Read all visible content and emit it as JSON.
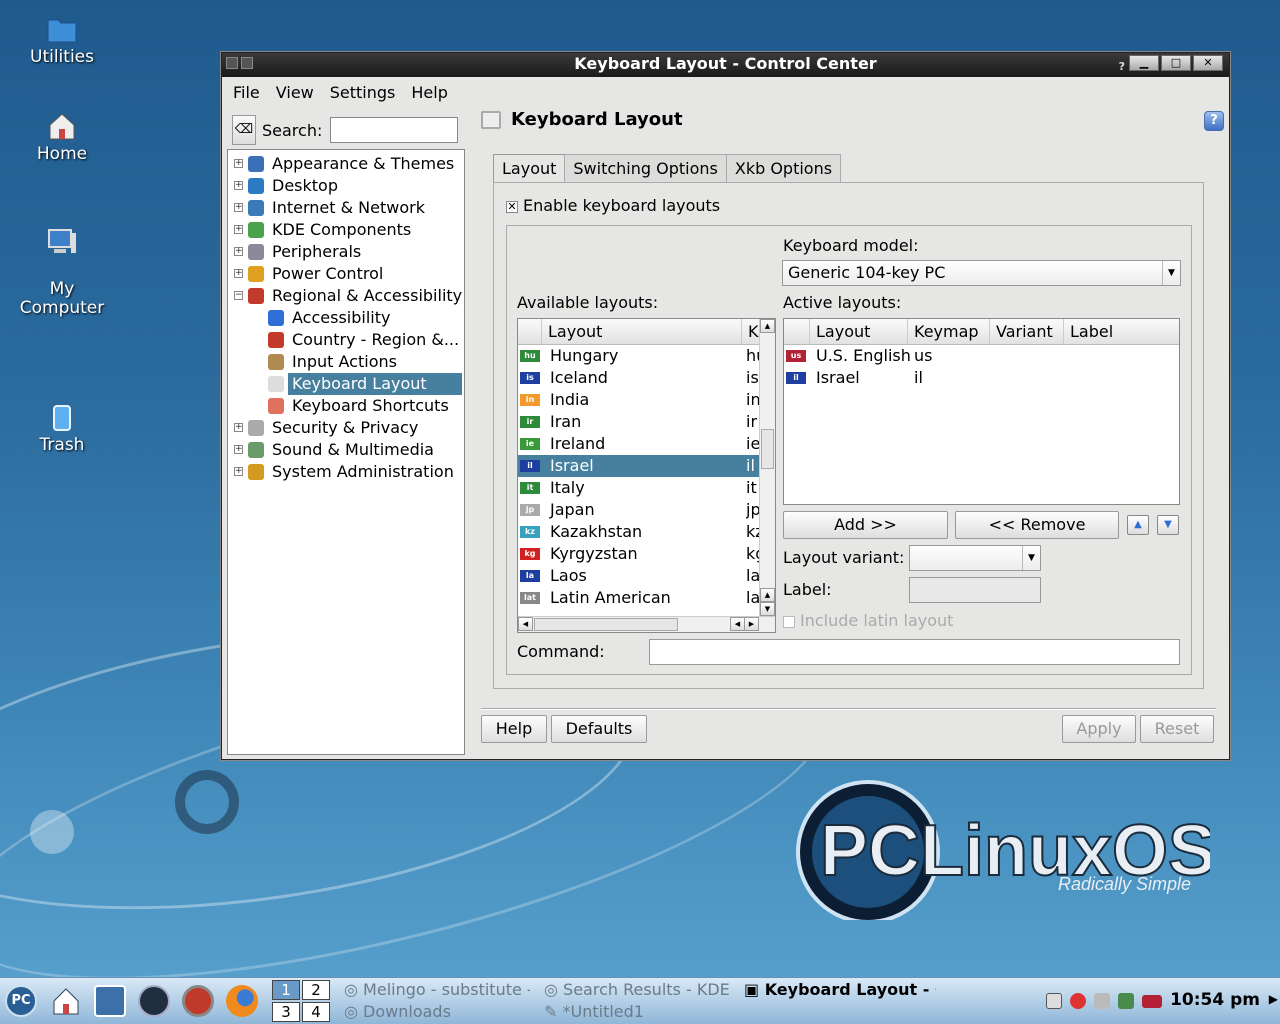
{
  "desktop": {
    "icons": [
      {
        "label": "Utilities",
        "icon": "folder-icon"
      },
      {
        "label": "Home",
        "icon": "home-icon"
      },
      {
        "label": "My\nComputer",
        "icon": "computer-icon"
      },
      {
        "label": "Trash",
        "icon": "trash-icon"
      }
    ],
    "logo": {
      "brand": "PCLinuxOS",
      "tagline": "Radically Simple"
    }
  },
  "window": {
    "title": "Keyboard Layout - Control Center",
    "title_help": "?",
    "menu": [
      "File",
      "View",
      "Settings",
      "Help"
    ],
    "search_label": "Search:",
    "search_value": "",
    "tree": [
      {
        "label": "Appearance & Themes",
        "expander": "+",
        "level": 0,
        "icon_color": "#3b6fb6"
      },
      {
        "label": "Desktop",
        "expander": "+",
        "level": 0,
        "icon_color": "#2a7bc2"
      },
      {
        "label": "Internet & Network",
        "expander": "+",
        "level": 0,
        "icon_color": "#3c79b7"
      },
      {
        "label": "KDE Components",
        "expander": "+",
        "level": 0,
        "icon_color": "#4aa24a"
      },
      {
        "label": "Peripherals",
        "expander": "+",
        "level": 0,
        "icon_color": "#8a8a9a"
      },
      {
        "label": "Power Control",
        "expander": "+",
        "level": 0,
        "icon_color": "#e0a020"
      },
      {
        "label": "Regional & Accessibility",
        "expander": "−",
        "level": 0,
        "icon_color": "#c23a2a"
      },
      {
        "label": "Accessibility",
        "expander": "",
        "level": 1,
        "icon_color": "#2f6ed8"
      },
      {
        "label": "Country - Region &...",
        "expander": "",
        "level": 1,
        "icon_color": "#c23a2a"
      },
      {
        "label": "Input Actions",
        "expander": "",
        "level": 1,
        "icon_color": "#b08a50"
      },
      {
        "label": "Keyboard Layout",
        "expander": "",
        "level": 1,
        "icon_color": "#dddddd",
        "selected": true
      },
      {
        "label": "Keyboard Shortcuts",
        "expander": "",
        "level": 1,
        "icon_color": "#e07060"
      },
      {
        "label": "Security & Privacy",
        "expander": "+",
        "level": 0,
        "icon_color": "#aaaaaa"
      },
      {
        "label": "Sound & Multimedia",
        "expander": "+",
        "level": 0,
        "icon_color": "#6a9a6a"
      },
      {
        "label": "System Administration",
        "expander": "+",
        "level": 0,
        "icon_color": "#d49a20"
      }
    ],
    "panel_title": "Keyboard Layout",
    "tabs": [
      "Layout",
      "Switching Options",
      "Xkb Options"
    ],
    "enable_label": "Enable keyboard layouts",
    "enable_checked": "✕",
    "model_label": "Keyboard model:",
    "model_value": "Generic 104-key PC",
    "available_label": "Available layouts:",
    "available_headers": [
      "Layout",
      "K"
    ],
    "available": [
      {
        "flag": "hu",
        "name": "Hungary",
        "code": "hu",
        "flag_color": "#2e8b3a"
      },
      {
        "flag": "is",
        "name": "Iceland",
        "code": "is",
        "flag_color": "#1e3fa0"
      },
      {
        "flag": "in",
        "name": "India",
        "code": "in",
        "flag_color": "#f29a2e"
      },
      {
        "flag": "ir",
        "name": "Iran",
        "code": "ir",
        "flag_color": "#2e8b3a"
      },
      {
        "flag": "ie",
        "name": "Ireland",
        "code": "ie",
        "flag_color": "#3a9a3a"
      },
      {
        "flag": "il",
        "name": "Israel",
        "code": "il",
        "flag_color": "#1e3fa0",
        "selected": true
      },
      {
        "flag": "it",
        "name": "Italy",
        "code": "it",
        "flag_color": "#2e8b3a"
      },
      {
        "flag": "jp",
        "name": "Japan",
        "code": "jp",
        "flag_color": "#aaaaaa"
      },
      {
        "flag": "kz",
        "name": "Kazakhstan",
        "code": "kz",
        "flag_color": "#3aa0c0"
      },
      {
        "flag": "kg",
        "name": "Kyrgyzstan",
        "code": "kg",
        "flag_color": "#d02020"
      },
      {
        "flag": "la",
        "name": "Laos",
        "code": "la",
        "flag_color": "#1e3fa0"
      },
      {
        "flag": "lat",
        "name": "Latin American",
        "code": "la",
        "flag_color": "#888888"
      }
    ],
    "active_label": "Active layouts:",
    "active_headers": [
      "Layout",
      "Keymap",
      "Variant",
      "Label"
    ],
    "active": [
      {
        "flag": "us",
        "name": "U.S. English",
        "keymap": "us",
        "flag_color": "#b22234"
      },
      {
        "flag": "il",
        "name": "Israel",
        "keymap": "il",
        "flag_color": "#1e3fa0"
      }
    ],
    "add_label": "Add >>",
    "remove_label": "<< Remove",
    "variant_label": "Layout variant:",
    "label_label": "Label:",
    "latin_label": "Include latin layout",
    "command_label": "Command:",
    "command_value": "",
    "buttons": {
      "help": "Help",
      "defaults": "Defaults",
      "apply": "Apply",
      "reset": "Reset"
    }
  },
  "taskbar": {
    "pager": [
      "1",
      "2",
      "3",
      "4"
    ],
    "tasks": [
      {
        "label": "Melingo - substitute -"
      },
      {
        "label": "Search Results - KDE"
      },
      {
        "label": "Keyboard Layout - C",
        "active": true
      },
      {
        "label": "Downloads"
      },
      {
        "label": "*Untitled1"
      }
    ],
    "start_label": "PC",
    "clock": "10:54 pm"
  }
}
